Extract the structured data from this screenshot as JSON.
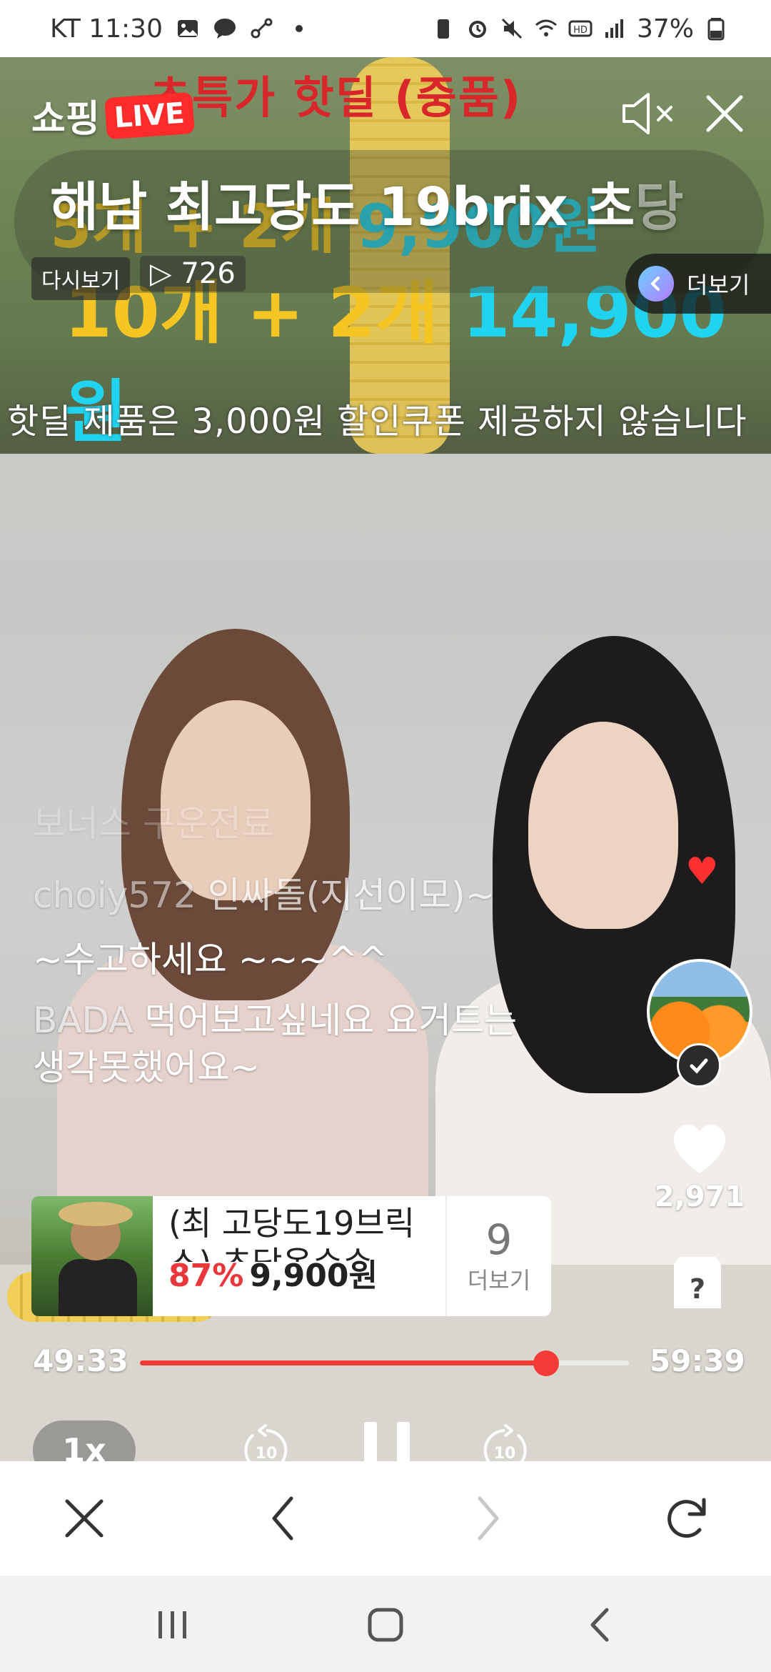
{
  "status_bar": {
    "carrier_time": "KT 11:30",
    "battery": "37%"
  },
  "banner": {
    "headline": "초특가 핫딜 (중품)",
    "line1_a": "5개 + 2개 ",
    "line1_b": "9,900원",
    "line2_a": "10개 + 2개 ",
    "line2_b": "14,900원",
    "note": "핫딜 제품은 3,000원 할인쿠폰 제공하지 않습니다"
  },
  "header": {
    "brand_shop": "쇼핑",
    "brand_live": "LIVE",
    "title": "해남  최고당도 19brix 초",
    "title_fade": "당",
    "replay_label": "다시보기",
    "view_count": "▷ 726",
    "more_label": "더보기"
  },
  "chat": [
    {
      "user": "",
      "text": "보너스 구운전료"
    },
    {
      "user": "choiy572",
      "text": " 인싸돌(지선이모)~"
    },
    {
      "user": "",
      "text": "~수고하세요 ~~~^^"
    },
    {
      "user": "BADA",
      "text": " 먹어보고싶네요 요거트는 생각못했어요~"
    }
  ],
  "right_rail": {
    "like_count": "2,971"
  },
  "product": {
    "name": "(최 고당도19브릭스) 초당옥수수",
    "discount": "87%",
    "price": "9,900원",
    "more_count": "9",
    "more_label": "더보기"
  },
  "player": {
    "current_time": "49:33",
    "total_time": "59:39",
    "progress": 0.83,
    "speed": "1x",
    "skip_seconds": "10"
  },
  "colors": {
    "accent_red": "#f23a36",
    "live_red": "#ff2a2a",
    "discount_red": "#e8383c"
  }
}
